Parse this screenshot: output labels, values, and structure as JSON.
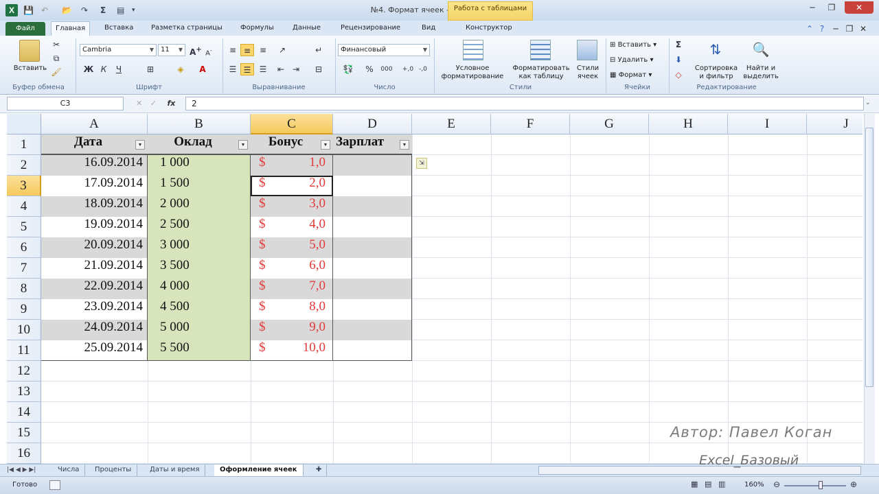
{
  "window": {
    "title": "№4. Формат ячеек - Microsoft Excel",
    "context_group": "Работа с таблицами",
    "app_icon": "X"
  },
  "tabs": [
    "Файл",
    "Главная",
    "Вставка",
    "Разметка страницы",
    "Формулы",
    "Данные",
    "Рецензирование",
    "Вид",
    "Конструктор"
  ],
  "ribbon": {
    "clipboard": {
      "paste": "Вставить",
      "label": "Буфер обмена"
    },
    "font": {
      "name": "Cambria",
      "size": "11",
      "bold": "Ж",
      "italic": "К",
      "underline": "Ч",
      "label": "Шрифт"
    },
    "alignment": {
      "label": "Выравнивание"
    },
    "number": {
      "format": "Финансовый",
      "label": "Число"
    },
    "styles": {
      "conditional": "Условное форматирование",
      "format_table": "Форматировать как таблицу",
      "cell_styles": "Стили ячеек",
      "label": "Стили"
    },
    "cells": {
      "insert": "Вставить",
      "delete": "Удалить",
      "format": "Формат",
      "label": "Ячейки"
    },
    "editing": {
      "sort": "Сортировка и фильтр",
      "find": "Найти и выделить",
      "label": "Редактирование"
    }
  },
  "formula_bar": {
    "name_box": "C3",
    "fx": "fx",
    "value": "2"
  },
  "columns": [
    "A",
    "B",
    "C",
    "D",
    "E",
    "F",
    "G",
    "H",
    "I",
    "J"
  ],
  "rows": [
    "1",
    "2",
    "3",
    "4",
    "5",
    "6",
    "7",
    "8",
    "9",
    "10",
    "11",
    "12",
    "13",
    "14",
    "15",
    "16"
  ],
  "table": {
    "headers": [
      "Дата",
      "Оклад",
      "Бонус",
      "Зарплат"
    ],
    "rows": [
      {
        "date": "16.09.2014",
        "salary": "1 000",
        "currency": "$",
        "bonus": "1,0"
      },
      {
        "date": "17.09.2014",
        "salary": "1 500",
        "currency": "$",
        "bonus": "2,0"
      },
      {
        "date": "18.09.2014",
        "salary": "2 000",
        "currency": "$",
        "bonus": "3,0"
      },
      {
        "date": "19.09.2014",
        "salary": "2 500",
        "currency": "$",
        "bonus": "4,0"
      },
      {
        "date": "20.09.2014",
        "salary": "3 000",
        "currency": "$",
        "bonus": "5,0"
      },
      {
        "date": "21.09.2014",
        "salary": "3 500",
        "currency": "$",
        "bonus": "6,0"
      },
      {
        "date": "22.09.2014",
        "salary": "4 000",
        "currency": "$",
        "bonus": "7,0"
      },
      {
        "date": "23.09.2014",
        "salary": "4 500",
        "currency": "$",
        "bonus": "8,0"
      },
      {
        "date": "24.09.2014",
        "salary": "5 000",
        "currency": "$",
        "bonus": "9,0"
      },
      {
        "date": "25.09.2014",
        "salary": "5 500",
        "currency": "$",
        "bonus": "10,0"
      }
    ]
  },
  "sheets": [
    "Числа",
    "Проценты",
    "Даты и время",
    "Оформление ячеек"
  ],
  "active_sheet_index": 3,
  "status": {
    "ready": "Готово",
    "zoom": "160%"
  },
  "watermark": {
    "author": "Автор: Павел Коган",
    "course": "Excel_Базовый"
  },
  "colors": {
    "accent_green": "#1f7244",
    "selected_header": "#f6c95c",
    "bonus_text": "#e23a3a",
    "salary_fill": "#d8e4bc",
    "band_fill": "#d9d9d9"
  }
}
